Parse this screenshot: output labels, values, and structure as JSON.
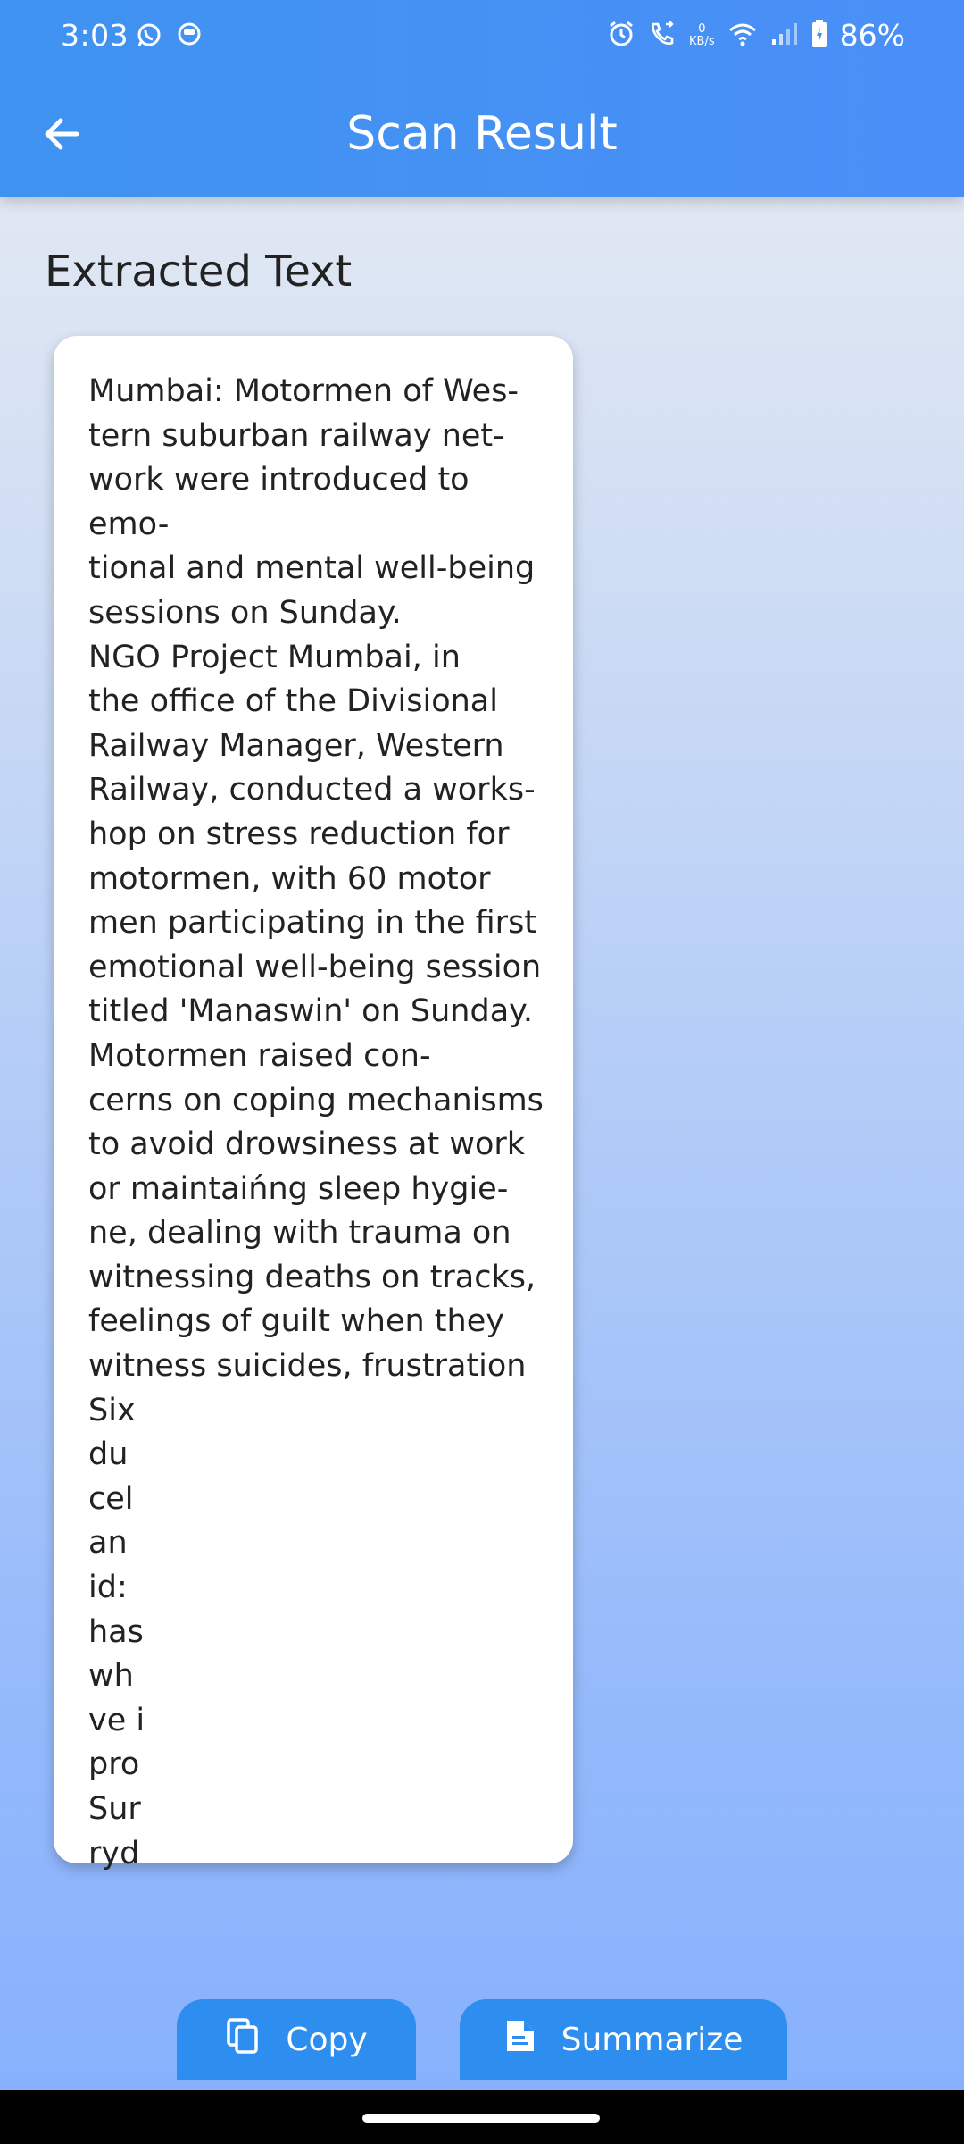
{
  "status_bar": {
    "time": "3:03",
    "left_icons": [
      "whatsapp-icon",
      "notification-icon"
    ],
    "right_icons": [
      "alarm-icon",
      "call-icon",
      "data-speed-icon",
      "wifi-icon",
      "signal-icon",
      "battery-icon"
    ],
    "data_speed_value": "0",
    "data_speed_unit": "KB/s",
    "battery": "86%"
  },
  "header": {
    "title": "Scan Result",
    "back_icon": "arrow-left-icon"
  },
  "main": {
    "section_title": "Extracted Text",
    "extracted_text": "Mumbai: Motormen of Wes-\ntern suburban railway net-\nwork were introduced to emo-\ntional and mental well-being\nsessions on Sunday.\nNGO Project Mumbai, in\nthe office of the Divisional\nRailway Manager, Western\nRailway, conducted a works-\nhop on stress reduction for\nmotormen, with 60 motor\nmen participating in the first\nemotional well-being session\ntitled 'Manaswin' on Sunday.\nMotormen raised con-\ncerns on coping mechanisms\nto avoid drowsiness at work\nor maintaińng sleep hygie-\nne, dealing with trauma on\nwitnessing deaths on tracks,\nfeelings of guilt when they\nwitness suicides, frustration\nSix\ndu\ncel\nan\nid:\nhas\nwh\nve i\npro\nSur\nryd"
  },
  "actions": {
    "copy_label": "Copy",
    "copy_icon": "copy-icon",
    "summarize_label": "Summarize",
    "summarize_icon": "document-icon"
  },
  "colors": {
    "header": "#4290f4",
    "button": "#2d8ef0",
    "card": "#ffffff",
    "text": "#222222"
  }
}
